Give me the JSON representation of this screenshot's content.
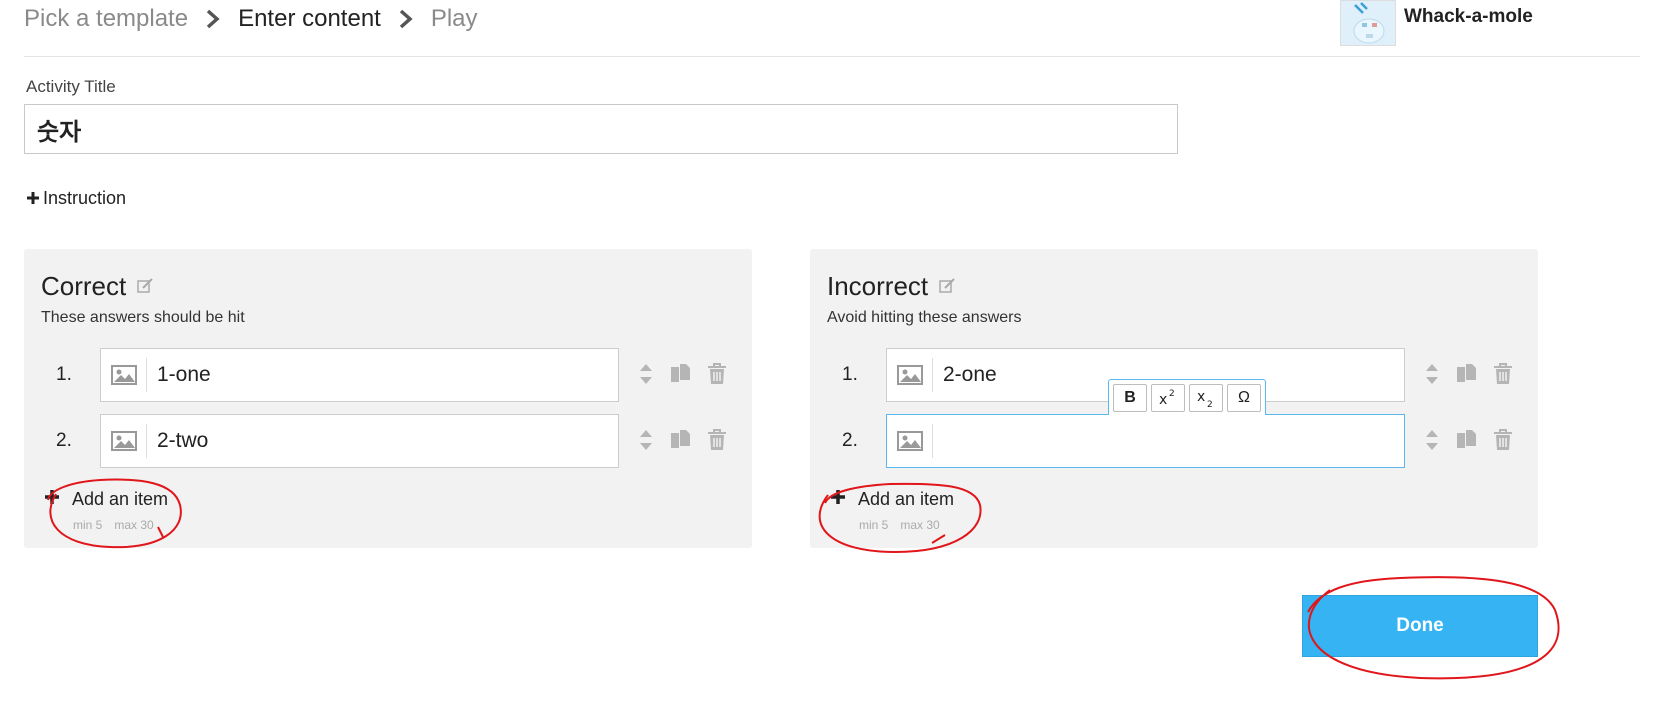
{
  "breadcrumb": {
    "step1": "Pick a template",
    "step2": "Enter content",
    "step3": "Play"
  },
  "template": {
    "name": "Whack-a-mole"
  },
  "activity": {
    "label": "Activity Title",
    "value": "숫자"
  },
  "instruction": {
    "label": "Instruction"
  },
  "panels": {
    "correct": {
      "title": "Correct",
      "subtitle": "These answers should be hit",
      "items": [
        {
          "num": "1.",
          "text": "1-one"
        },
        {
          "num": "2.",
          "text": "2-two"
        }
      ],
      "add_label": "Add an item",
      "min": "min 5",
      "max": "max 30"
    },
    "incorrect": {
      "title": "Incorrect",
      "subtitle": "Avoid hitting these answers",
      "items": [
        {
          "num": "1.",
          "text": "2-one"
        },
        {
          "num": "2.",
          "text": ""
        }
      ],
      "add_label": "Add an item",
      "min": "min 5",
      "max": "max 30"
    }
  },
  "toolbar": {
    "bold": "B",
    "omega": "Ω"
  },
  "done": {
    "label": "Done"
  },
  "colors": {
    "accent": "#35b3f2",
    "panel_bg": "#f2f2f2",
    "annotation": "#e0161b"
  }
}
